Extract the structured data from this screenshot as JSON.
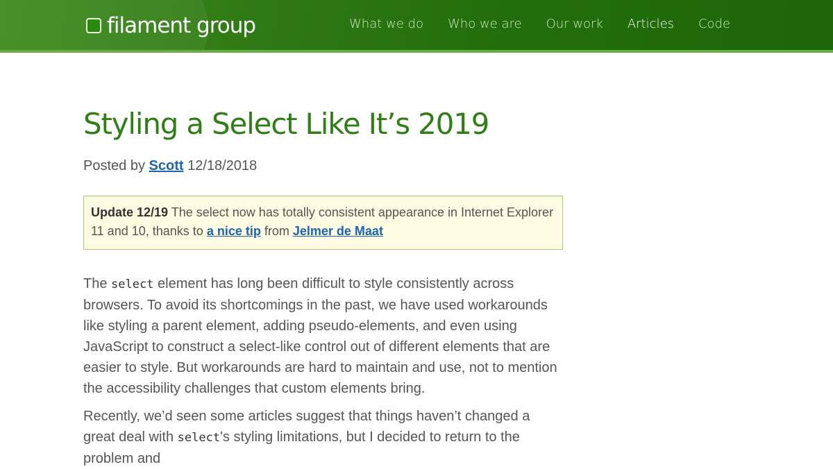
{
  "header": {
    "logo_text": "filament group",
    "nav": [
      {
        "label": "What we do"
      },
      {
        "label": "Who we are"
      },
      {
        "label": "Our work"
      },
      {
        "label": "Articles"
      },
      {
        "label": "Code"
      }
    ]
  },
  "article": {
    "title": "Styling a Select Like It’s 2019",
    "meta": {
      "posted_by": "Posted by",
      "author": "Scott",
      "date": "12/18/2018"
    },
    "notice": {
      "heading": "Update 12/19",
      "text1": "The select now has totally consistent appearance in Internet Explorer 11 and 10, thanks to",
      "link1": "a nice tip",
      "text2": "from",
      "link2": "Jelmer de Maat"
    },
    "para1": {
      "pre": "The",
      "code": "select",
      "post": "element has long been difficult to style consistently across browsers. To avoid its shortcomings in the past, we have used workarounds like styling a parent element, adding pseudo-elements, and even using JavaScript to construct a select-like control out of different elements that are easier to style. But workarounds are hard to maintain and use, not to mention the accessibility challenges that custom elements bring."
    },
    "para2": {
      "pre": "Recently, we’d seen some articles suggest that things haven’t changed a great deal with",
      "code": "select",
      "post": "'s styling limitations, but I decided to return to the problem and"
    }
  },
  "colors": {
    "header_green": "#2f7a14",
    "title_green": "#2f7e16",
    "link_blue": "#1a64b0",
    "notice_bg": "#fdfbe2",
    "notice_border": "#a9c77d"
  }
}
